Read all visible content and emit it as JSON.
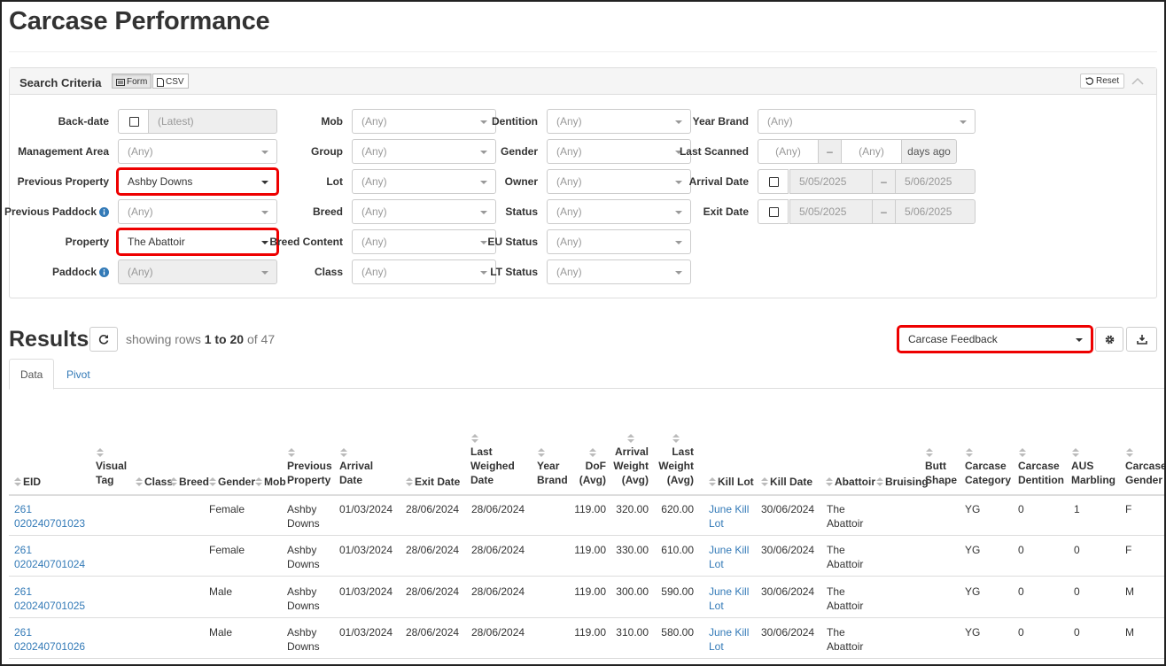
{
  "page": {
    "title": "Carcase Performance"
  },
  "search": {
    "title": "Search Criteria",
    "form_label": "Form",
    "csv_label": "CSV",
    "reset_label": "Reset",
    "backdate": {
      "label": "Back-date",
      "placeholder": "(Latest)"
    },
    "management_area": {
      "label": "Management Area",
      "value": "(Any)"
    },
    "previous_property": {
      "label": "Previous Property",
      "value": "Ashby Downs"
    },
    "previous_paddock": {
      "label": "Previous Paddock",
      "value": "(Any)"
    },
    "property": {
      "label": "Property",
      "value": "The Abattoir"
    },
    "paddock": {
      "label": "Paddock",
      "value": "(Any)"
    },
    "mob": {
      "label": "Mob",
      "value": "(Any)"
    },
    "group": {
      "label": "Group",
      "value": "(Any)"
    },
    "lot": {
      "label": "Lot",
      "value": "(Any)"
    },
    "breed": {
      "label": "Breed",
      "value": "(Any)"
    },
    "breed_content": {
      "label": "Breed Content",
      "value": "(Any)"
    },
    "class": {
      "label": "Class",
      "value": "(Any)"
    },
    "dentition": {
      "label": "Dentition",
      "value": "(Any)"
    },
    "gender": {
      "label": "Gender",
      "value": "(Any)"
    },
    "owner": {
      "label": "Owner",
      "value": "(Any)"
    },
    "status": {
      "label": "Status",
      "value": "(Any)"
    },
    "eu_status": {
      "label": "EU Status",
      "value": "(Any)"
    },
    "lt_status": {
      "label": "LT Status",
      "value": "(Any)"
    },
    "year_brand": {
      "label": "Year Brand",
      "value": "(Any)"
    },
    "last_scanned": {
      "label": "Last Scanned",
      "from": "(Any)",
      "sep": "–",
      "to": "(Any)",
      "suffix": "days ago"
    },
    "arrival_date": {
      "label": "Arrival Date",
      "from": "5/05/2025",
      "sep": "–",
      "to": "5/06/2025"
    },
    "exit_date": {
      "label": "Exit Date",
      "from": "5/05/2025",
      "sep": "–",
      "to": "5/06/2025"
    }
  },
  "results": {
    "title": "Results",
    "showing_prefix": "showing rows",
    "range": "1 to 20",
    "of_text": "of 47",
    "report_select": "Carcase Feedback",
    "tabs": [
      "Data",
      "Pivot"
    ]
  },
  "table": {
    "headers": {
      "eid": "EID",
      "visual_tag": [
        "Visual",
        "Tag"
      ],
      "class": "Class",
      "breed": "Breed",
      "gender": "Gender",
      "mob": "Mob",
      "previous_property": [
        "Previous",
        "Property"
      ],
      "arrival_date": [
        "Arrival",
        "Date"
      ],
      "exit_date": "Exit Date",
      "last_weighed_date": [
        "Last",
        "Weighed",
        "Date"
      ],
      "year_brand": [
        "Year",
        "Brand"
      ],
      "dof_avg": [
        "DoF",
        "(Avg)"
      ],
      "arrival_weight": [
        "Arrival",
        "Weight",
        "(Avg)"
      ],
      "last_weight": [
        "Last",
        "Weight",
        "(Avg)"
      ],
      "kill_lot": "Kill Lot",
      "kill_date": "Kill Date",
      "abattoir": "Abattoir",
      "bruising": "Bruising",
      "butt_shape": [
        "Butt",
        "Shape"
      ],
      "carcase_category": [
        "Carcase",
        "Category"
      ],
      "carcase_dentition": [
        "Carcase",
        "Dentition"
      ],
      "aus_marbling": [
        "AUS",
        "Marbling"
      ],
      "carcase_gender": [
        "Carcase",
        "Gender"
      ]
    },
    "rows": [
      {
        "eid1": "261",
        "eid2": "020240701023",
        "gender": "Female",
        "prev1": "Ashby",
        "prev2": "Downs",
        "arrival": "01/03/2024",
        "exit": "28/06/2024",
        "weighed": "28/06/2024",
        "dof": "119.00",
        "arrw": "320.00",
        "lastw": "620.00",
        "lot1": "June Kill",
        "lot2": "Lot",
        "kill": "30/06/2024",
        "ab1": "The",
        "ab2": "Abattoir",
        "cat": "YG",
        "dent": "0",
        "marb": "1",
        "cg": "F"
      },
      {
        "eid1": "261",
        "eid2": "020240701024",
        "gender": "Female",
        "prev1": "Ashby",
        "prev2": "Downs",
        "arrival": "01/03/2024",
        "exit": "28/06/2024",
        "weighed": "28/06/2024",
        "dof": "119.00",
        "arrw": "330.00",
        "lastw": "610.00",
        "lot1": "June Kill",
        "lot2": "Lot",
        "kill": "30/06/2024",
        "ab1": "The",
        "ab2": "Abattoir",
        "cat": "YG",
        "dent": "0",
        "marb": "0",
        "cg": "F"
      },
      {
        "eid1": "261",
        "eid2": "020240701025",
        "gender": "Male",
        "prev1": "Ashby",
        "prev2": "Downs",
        "arrival": "01/03/2024",
        "exit": "28/06/2024",
        "weighed": "28/06/2024",
        "dof": "119.00",
        "arrw": "300.00",
        "lastw": "590.00",
        "lot1": "June Kill",
        "lot2": "Lot",
        "kill": "30/06/2024",
        "ab1": "The",
        "ab2": "Abattoir",
        "cat": "YG",
        "dent": "0",
        "marb": "0",
        "cg": "M"
      },
      {
        "eid1": "261",
        "eid2": "020240701026",
        "gender": "Male",
        "prev1": "Ashby",
        "prev2": "Downs",
        "arrival": "01/03/2024",
        "exit": "28/06/2024",
        "weighed": "28/06/2024",
        "dof": "119.00",
        "arrw": "310.00",
        "lastw": "580.00",
        "lot1": "June Kill",
        "lot2": "Lot",
        "kill": "30/06/2024",
        "ab1": "The",
        "ab2": "Abattoir",
        "cat": "YG",
        "dent": "0",
        "marb": "0",
        "cg": "M"
      }
    ]
  },
  "colors": {
    "accent_link": "#337ab7",
    "highlight": "#e00000",
    "border": "#cccccc"
  }
}
